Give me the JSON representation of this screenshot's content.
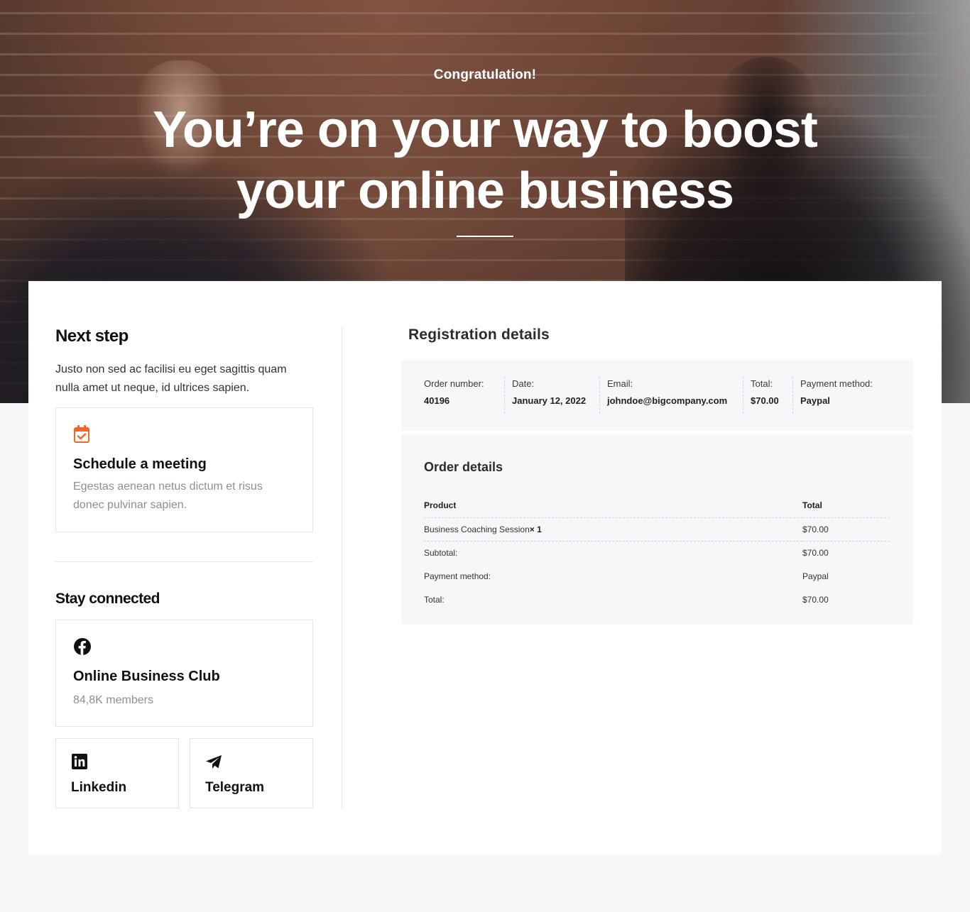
{
  "hero": {
    "subtitle": "Congratulation!",
    "title_line1": "You’re on your way to boost",
    "title_line2": "your online business"
  },
  "next_step": {
    "title": "Next step",
    "intro": "Justo non sed ac facilisi eu eget sagittis quam nulla amet ut neque, id ultrices sapien.",
    "meeting": {
      "icon": "calendar-check-icon",
      "title": "Schedule a meeting",
      "description": "Egestas aenean netus dictum et risus donec pulvinar sapien."
    }
  },
  "stay_connected": {
    "title": "Stay connected",
    "facebook": {
      "icon": "facebook-icon",
      "title": "Online Business Club",
      "members": "84,8K members"
    },
    "linkedin": {
      "icon": "linkedin-icon",
      "label": "Linkedin"
    },
    "telegram": {
      "icon": "telegram-icon",
      "label": "Telegram"
    }
  },
  "registration": {
    "title": "Registration details",
    "fields": [
      {
        "label": "Order number:",
        "value": "40196"
      },
      {
        "label": "Date:",
        "value": "January 12, 2022"
      },
      {
        "label": "Email:",
        "value": "johndoe@bigcompany.com"
      },
      {
        "label": "Total:",
        "value": "$70.00"
      },
      {
        "label": "Payment method:",
        "value": "Paypal"
      }
    ]
  },
  "order": {
    "title": "Order details",
    "header_product": "Product",
    "header_total": "Total",
    "item_name": "Business Coaching Session",
    "item_qty": "× 1",
    "item_total": "$70.00",
    "subtotal_label": "Subtotal:",
    "subtotal_value": "$70.00",
    "payment_label": "Payment method:",
    "payment_value": "Paypal",
    "total_label": "Total:",
    "total_value": "$70.00"
  },
  "colors": {
    "accent": "#f26522",
    "page_bg": "#f6f7f9"
  }
}
